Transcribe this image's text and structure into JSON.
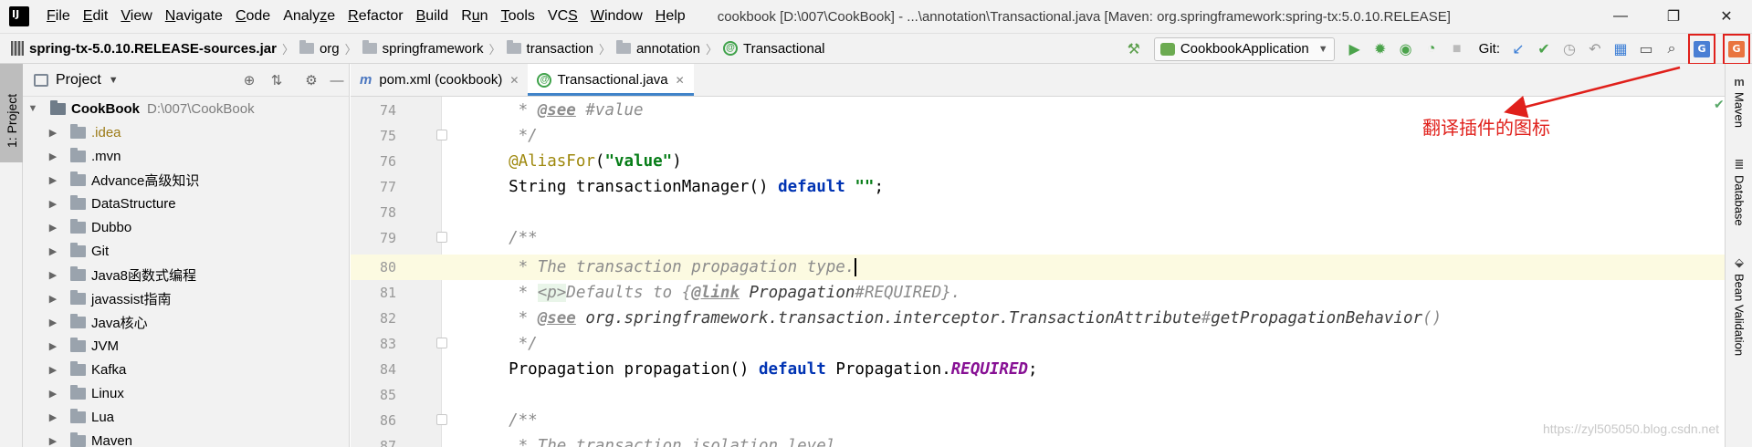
{
  "menu": {
    "items": [
      {
        "label": "File",
        "mnemonic": "F"
      },
      {
        "label": "Edit",
        "mnemonic": "E"
      },
      {
        "label": "View",
        "mnemonic": "V"
      },
      {
        "label": "Navigate",
        "mnemonic": "N"
      },
      {
        "label": "Code",
        "mnemonic": "C"
      },
      {
        "label": "Analyze",
        "mnemonic": "z"
      },
      {
        "label": "Refactor",
        "mnemonic": "R"
      },
      {
        "label": "Build",
        "mnemonic": "B"
      },
      {
        "label": "Run",
        "mnemonic": "u"
      },
      {
        "label": "Tools",
        "mnemonic": "T"
      },
      {
        "label": "VCS",
        "mnemonic": "S"
      },
      {
        "label": "Window",
        "mnemonic": "W"
      },
      {
        "label": "Help",
        "mnemonic": "H"
      }
    ],
    "window_title": "cookbook [D:\\007\\CookBook] - ...\\annotation\\Transactional.java [Maven: org.springframework:spring-tx:5.0.10.RELEASE]"
  },
  "window_controls": {
    "minimize": "—",
    "restore": "❐",
    "close": "✕"
  },
  "breadcrumb": [
    {
      "label": "spring-tx-5.0.10.RELEASE-sources.jar",
      "icon": "jar-icon"
    },
    {
      "label": "org",
      "icon": "package-icon"
    },
    {
      "label": "springframework",
      "icon": "package-icon"
    },
    {
      "label": "transaction",
      "icon": "package-icon"
    },
    {
      "label": "annotation",
      "icon": "package-icon"
    },
    {
      "label": "Transactional",
      "icon": "annotation-icon"
    }
  ],
  "toolbar": {
    "run_config": "CookbookApplication",
    "git_label": "Git:",
    "icons": [
      "build-hammer-icon",
      "run-icon",
      "debug-icon",
      "run-with-coverage-icon",
      "profile-icon",
      "stop-icon",
      "git-update-icon",
      "git-commit-icon",
      "git-history-icon",
      "git-rollback-icon",
      "project-structure-icon",
      "terminal-icon",
      "search-everywhere-icon",
      "translate-plugin-icon",
      "translate-plugin-alt-icon"
    ]
  },
  "left_strip": {
    "tab_label": "1: Project"
  },
  "project_panel": {
    "title": "Project",
    "root": {
      "name": "CookBook",
      "path": "D:\\007\\CookBook"
    },
    "items": [
      ".idea",
      ".mvn",
      "Advance高级知识",
      "DataStructure",
      "Dubbo",
      "Git",
      "Java8函数式编程",
      "javassist指南",
      "Java核心",
      "JVM",
      "Kafka",
      "Linux",
      "Lua",
      "Maven"
    ]
  },
  "editor": {
    "tabs": [
      {
        "label": "pom.xml (cookbook)",
        "icon": "maven-m-icon",
        "active": false
      },
      {
        "label": "Transactional.java",
        "icon": "annotation-icon",
        "active": true
      }
    ],
    "current_line": 80,
    "lines": [
      {
        "num": "74",
        "text": "   * @see #value"
      },
      {
        "num": "75",
        "text": "   */"
      },
      {
        "num": "76",
        "text": "  @AliasFor(\"value\")"
      },
      {
        "num": "77",
        "text": "  String transactionManager() default \"\";"
      },
      {
        "num": "78",
        "text": ""
      },
      {
        "num": "79",
        "text": "  /**"
      },
      {
        "num": "80",
        "text": "   * The transaction propagation type."
      },
      {
        "num": "81",
        "text": "   * <p>Defaults to {@link Propagation#REQUIRED}."
      },
      {
        "num": "82",
        "text": "   * @see org.springframework.transaction.interceptor.TransactionAttribute#getPropagationBehavior()"
      },
      {
        "num": "83",
        "text": "   */"
      },
      {
        "num": "84",
        "text": "  Propagation propagation() default Propagation.REQUIRED;"
      },
      {
        "num": "85",
        "text": ""
      },
      {
        "num": "86",
        "text": "  /**"
      },
      {
        "num": "87",
        "text": "   * The transaction isolation level."
      }
    ]
  },
  "right_strip": {
    "items": [
      "Maven",
      "Database",
      "Bean Validation"
    ]
  },
  "annotation": {
    "text": "翻译插件的图标",
    "color": "#e0201b"
  },
  "watermark": "https://zyl505050.blog.csdn.net",
  "colors": {
    "accent": "#4083c9",
    "highlight_line": "#fcfae1",
    "annotation_red": "#e0201b",
    "keyword": "#0033b3",
    "string": "#067d17",
    "annotation": "#9e880d"
  }
}
